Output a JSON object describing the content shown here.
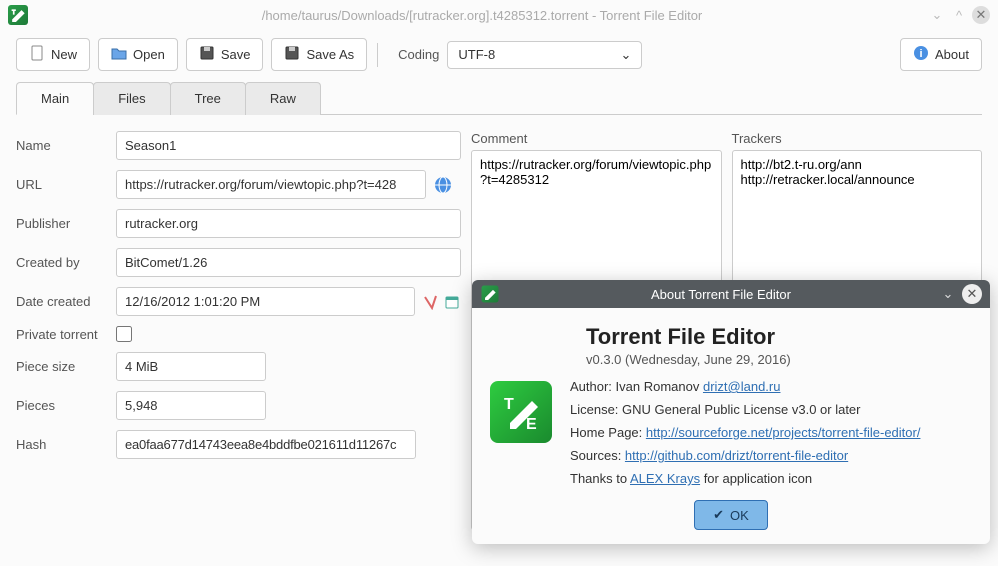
{
  "window": {
    "title": "/home/taurus/Downloads/[rutracker.org].t4285312.torrent - Torrent File Editor"
  },
  "toolbar": {
    "new_label": "New",
    "open_label": "Open",
    "save_label": "Save",
    "save_as_label": "Save As",
    "coding_label": "Coding",
    "coding_value": "UTF-8",
    "about_label": "About"
  },
  "tabs": [
    "Main",
    "Files",
    "Tree",
    "Raw"
  ],
  "form": {
    "name_label": "Name",
    "name": "Season1",
    "url_label": "URL",
    "url": "https://rutracker.org/forum/viewtopic.php?t=428",
    "publisher_label": "Publisher",
    "publisher": "rutracker.org",
    "created_by_label": "Created by",
    "created_by": "BitComet/1.26",
    "date_label": "Date created",
    "date": "12/16/2012 1:01:20 PM",
    "private_label": "Private torrent",
    "piece_size_label": "Piece size",
    "piece_size": "4 MiB",
    "pieces_label": "Pieces",
    "pieces": "5,948",
    "hash_label": "Hash",
    "hash": "ea0faa677d14743eea8e4bddfbe021611d11267c"
  },
  "comment": {
    "label": "Comment",
    "value": "https://rutracker.org/forum/viewtopic.php?t=4285312"
  },
  "trackers": {
    "label": "Trackers",
    "value": "http://bt2.t-ru.org/ann\nhttp://retracker.local/announce"
  },
  "about": {
    "title": "About Torrent File Editor",
    "app_name": "Torrent File Editor",
    "version": "v0.3.0 (Wednesday, June 29, 2016)",
    "author_label": "Author: ",
    "author_name": "Ivan Romanov ",
    "author_link": "drizt@land.ru",
    "license_label": "License: ",
    "license": "GNU General Public License v3.0 or later",
    "homepage_label": "Home Page: ",
    "homepage": "http://sourceforge.net/projects/torrent-file-editor/",
    "sources_label": "Sources: ",
    "sources": "http://github.com/drizt/torrent-file-editor",
    "thanks_prefix": "Thanks to ",
    "thanks_link": "ALEX Krays",
    "thanks_suffix": " for application icon",
    "ok_label": "OK"
  }
}
